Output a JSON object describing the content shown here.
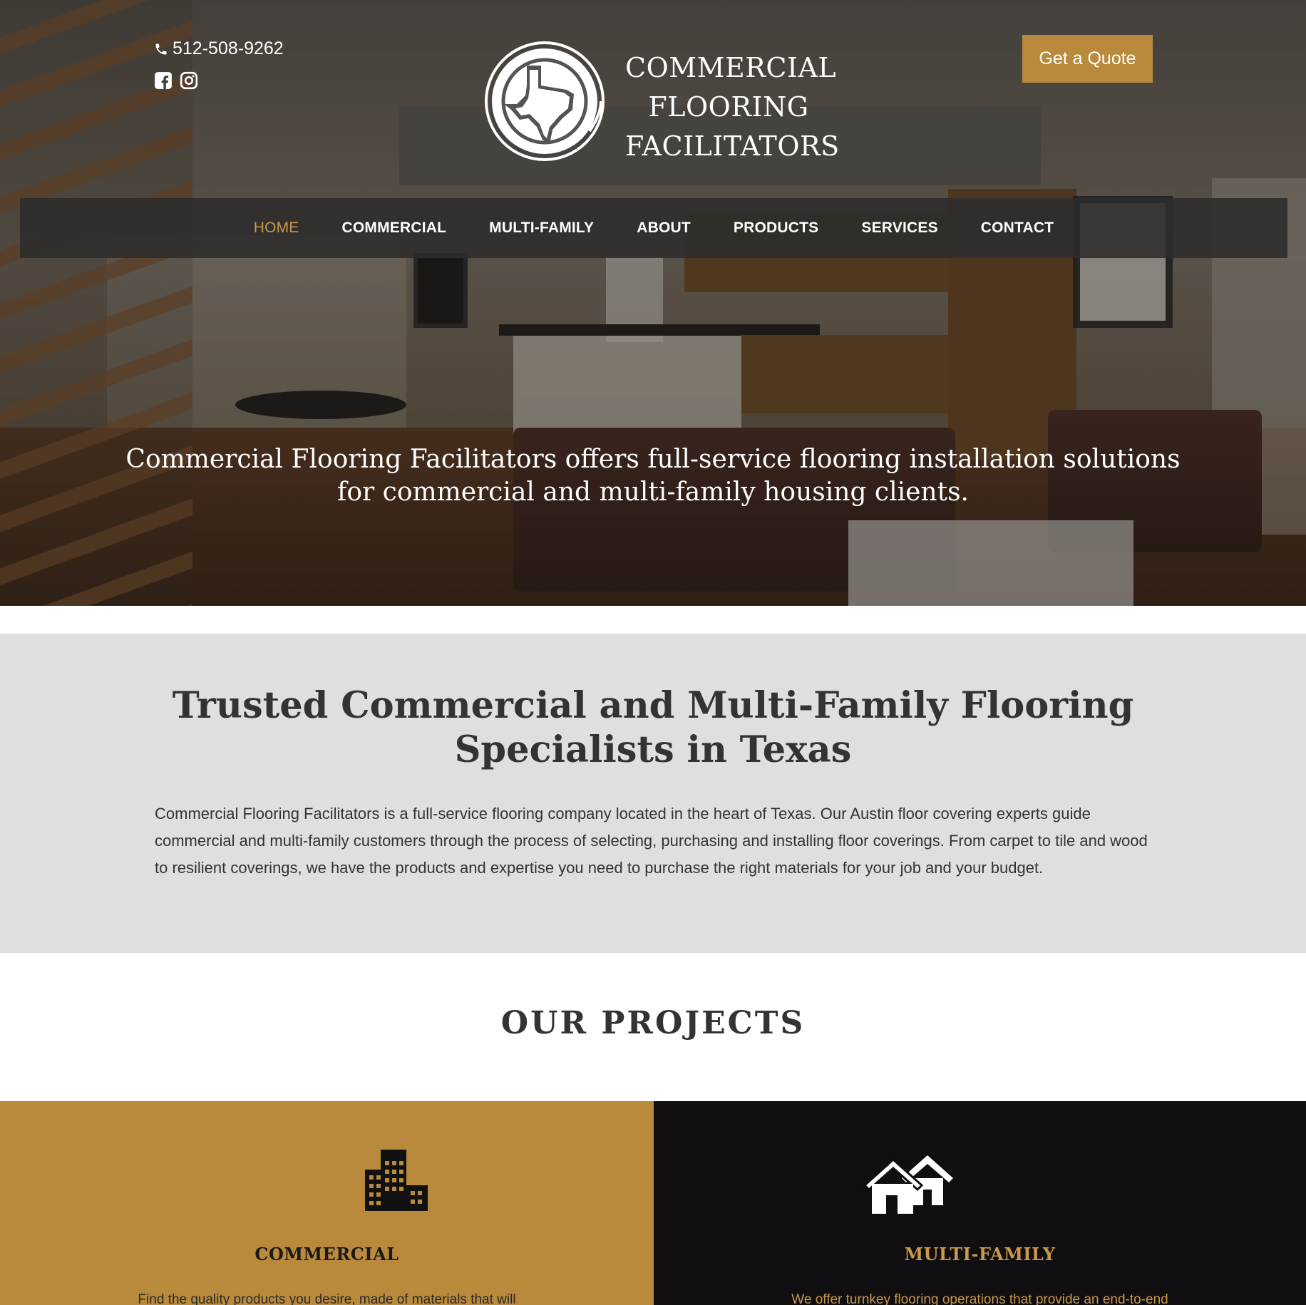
{
  "header": {
    "phone": "512-508-9262",
    "social": [
      "facebook-icon",
      "instagram-icon"
    ],
    "logo_lines": [
      "COMMERCIAL",
      "FLOORING",
      "FACILITATORS"
    ],
    "quote_button": "Get a Quote"
  },
  "nav": {
    "items": [
      {
        "label": "HOME",
        "active": true
      },
      {
        "label": "COMMERCIAL"
      },
      {
        "label": "MULTI-FAMILY"
      },
      {
        "label": "ABOUT"
      },
      {
        "label": "PRODUCTS"
      },
      {
        "label": "SERVICES"
      },
      {
        "label": "CONTACT"
      }
    ]
  },
  "hero": {
    "tagline": "Commercial Flooring Facilitators offers full-service flooring installation solutions for commercial and multi-family housing clients."
  },
  "trusted": {
    "title": "Trusted Commercial and Multi-Family Flooring Specialists in Texas",
    "body": "Commercial Flooring Facilitators is a full-service flooring company located in the heart of Texas. Our Austin floor covering experts guide commercial and multi-family customers through the process of selecting, purchasing and installing floor coverings. From carpet to tile and wood to resilient coverings, we have the products and expertise you need to purchase the right materials for your job and your budget."
  },
  "projects": {
    "title": "OUR PROJECTS",
    "cards": [
      {
        "title": "COMMERCIAL",
        "text": "Find the quality products you desire, made of materials that will",
        "icon": "buildings-icon"
      },
      {
        "title": "MULTI-FAMILY",
        "text": "We offer turnkey flooring operations that provide an end-to-end",
        "icon": "houses-icon"
      }
    ]
  },
  "colors": {
    "accent": "#b98a3c",
    "dark": "#100e10",
    "section_gray": "#dfdfdf"
  }
}
